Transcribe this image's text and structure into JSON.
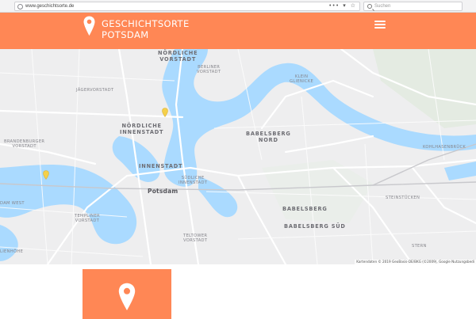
{
  "browser": {
    "url": "www.geschichtsorte.de",
    "page_actions": "•••",
    "search_placeholder": "Suchen"
  },
  "header": {
    "title_line1": "GESCHICHTSORTE",
    "title_line2": "POTSDAM",
    "logo_icon": "map-pin-icon",
    "menu_icon": "hamburger-menu-icon",
    "background": "#ff8755"
  },
  "map": {
    "labels": {
      "noerdliche_vorstadt": "NÖRDLICHE\nVORSTADT",
      "berliner_vorstadt": "BERLINER\nVORSTADT",
      "klein_glienicke": "KLEIN\nGLIENICKE",
      "jaegervorstadt": "JÄGERVORSTADT",
      "noerdliche_innenstadt": "NÖRDLICHE\nINNENSTADT",
      "babelsberg_nord": "BABELSBERG\nNORD",
      "brandenburger_vorstadt": "BRANDENBURGER\nVORSTADT",
      "kohlhasenbrueck": "KOHLHASENBRÜCK",
      "innenstadt": "INNENSTADT",
      "suedliche_innenstadt": "SÜDLICHE\nINNENSTADT",
      "potsdam": "Potsdam",
      "potsdam_west": "DAM WEST",
      "steinstuecken": "STEINSTÜCKEN",
      "babelsberg": "BABELSBERG",
      "templiner_vorstadt": "TEMPLINER\nVORSTADT",
      "babelsberg_sued": "BABELSBERG SÜD",
      "teltower_vorstadt": "TELTOWER\nVORSTADT",
      "stern": "STERN",
      "lienhoehe": "LIENHÖHE"
    },
    "attribution": "Kartendaten © 2019 GeoBasis-DE/BKG (©2009), Google    Nutzungsbedi",
    "water_color": "#aadaff",
    "marker_color": "#f5d04a"
  },
  "card": {
    "icon": "map-pin-icon",
    "background": "#ff8755"
  }
}
